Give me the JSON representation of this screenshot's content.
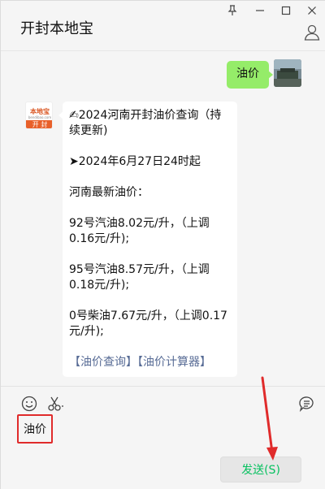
{
  "window": {
    "title": "开封本地宝",
    "controls": {
      "pin_icon": "pin-icon",
      "min_icon": "minimize-icon",
      "max_icon": "maximize-icon",
      "close_icon": "close-icon",
      "pin": "⊥",
      "min": "—",
      "max": "☐",
      "close": "✕"
    },
    "contact_icon": "person-icon"
  },
  "chat": {
    "my_message": "油价",
    "bot_avatar": {
      "brand_top": "本地宝",
      "brand_sub": "bendibao.com",
      "city": "开 封"
    },
    "bot_message": {
      "title": "✍2024河南开封油价查询（持续更新)",
      "start_time": "➤2024年6月27日24时起",
      "heading": "河南最新油价：",
      "p92": "92号汽油8.02元/升，（上调0.16元/升);",
      "p95": "95号汽油8.57元/升，（上调0.18元/升);",
      "p0": "0号柴油7.67元/升，（上调0.17元/升);",
      "link_bracket_open_1": "【",
      "link1": "油价查询",
      "link_bracket_close_1": "】",
      "link_bracket_open_2": "【",
      "link2": "油价计算器",
      "link_bracket_close_2": "】"
    }
  },
  "input": {
    "text": "油价",
    "send_label": "发送(S)"
  },
  "colors": {
    "my_bubble": "#95ec69",
    "send_text": "#07c160",
    "link": "#576b95",
    "annotation_red": "#e02b2b"
  }
}
